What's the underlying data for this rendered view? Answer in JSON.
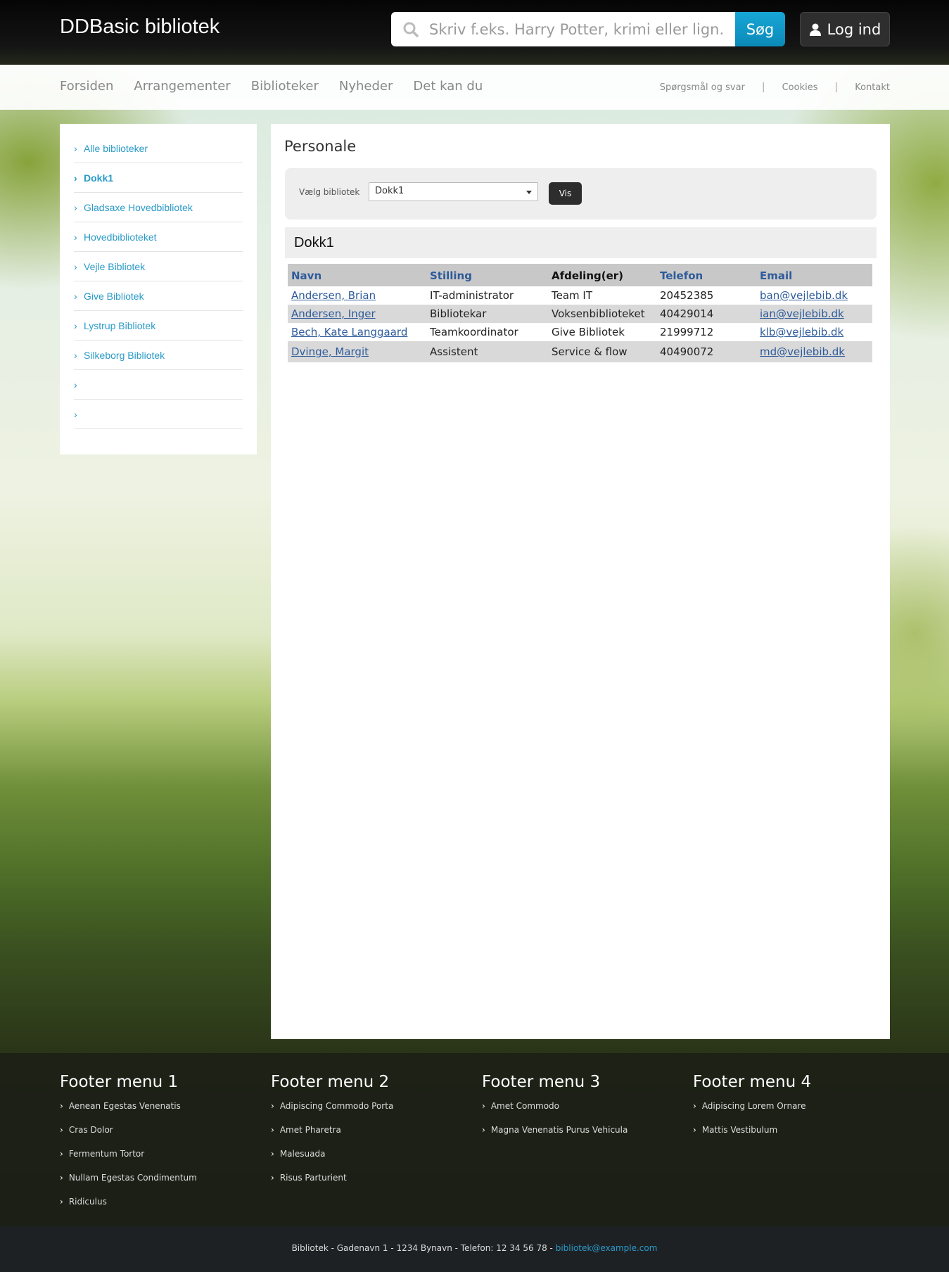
{
  "header": {
    "site_title": "DDBasic bibliotek",
    "search_placeholder": "Skriv f.eks. Harry Potter, krimi eller lign.",
    "search_button": "Søg",
    "login_button": "Log ind"
  },
  "nav": {
    "main": [
      "Forsiden",
      "Arrangementer",
      "Biblioteker",
      "Nyheder",
      "Det kan du"
    ],
    "secondary": [
      "Spørgsmål og svar",
      "Cookies",
      "Kontakt"
    ]
  },
  "sidebar": {
    "items": [
      {
        "label": "Alle biblioteker",
        "active": false
      },
      {
        "label": "Dokk1",
        "active": true
      },
      {
        "label": "Gladsaxe Hovedbibliotek",
        "active": false
      },
      {
        "label": "Hovedbiblioteket",
        "active": false
      },
      {
        "label": "Vejle Bibliotek",
        "active": false
      },
      {
        "label": "Give Bibliotek",
        "active": false
      },
      {
        "label": "Lystrup Bibliotek",
        "active": false
      },
      {
        "label": "Silkeborg Bibliotek",
        "active": false
      },
      {
        "label": "",
        "active": false
      },
      {
        "label": "",
        "active": false
      }
    ]
  },
  "main": {
    "title": "Personale",
    "filter": {
      "label": "Vælg bibliotek",
      "selected": "Dokk1",
      "button": "Vis"
    },
    "result_heading": "Dokk1",
    "table": {
      "headers": [
        "Navn",
        "Stilling",
        "Afdeling(er)",
        "Telefon",
        "Email"
      ],
      "rows": [
        [
          "Andersen, Brian",
          "IT-administrator",
          "Team IT",
          "20452385",
          "ban@vejlebib.dk"
        ],
        [
          "Andersen, Inger",
          "Bibliotekar",
          "Voksenbiblioteket",
          "40429014",
          "ian@vejlebib.dk"
        ],
        [
          "Bech, Kate Langgaard",
          "Teamkoordinator",
          "Give Bibliotek",
          "21999712",
          "klb@vejlebib.dk"
        ],
        [
          "Dvinge, Margit",
          "Assistent",
          "Service & flow",
          "40490072",
          "md@vejlebib.dk"
        ]
      ]
    }
  },
  "footer": {
    "columns": [
      {
        "title": "Footer menu 1",
        "items": [
          "Aenean Egestas Venenatis",
          "Cras Dolor",
          "Fermentum Tortor",
          "Nullam Egestas Condimentum",
          "Ridiculus"
        ]
      },
      {
        "title": "Footer menu 2",
        "items": [
          "Adipiscing Commodo Porta",
          "Amet Pharetra",
          "Malesuada",
          "Risus Parturient"
        ]
      },
      {
        "title": "Footer menu 3",
        "items": [
          "Amet Commodo",
          "Magna Venenatis Purus Vehicula"
        ]
      },
      {
        "title": "Footer menu 4",
        "items": [
          "Adipiscing Lorem Ornare",
          "Mattis Vestibulum"
        ]
      }
    ],
    "address_text": "Bibliotek - Gadenavn 1 - 1234 Bynavn - Telefon: 12 34 56 78 - ",
    "email": "bibliotek@example.com"
  },
  "colors": {
    "accent": "#2a9ac8",
    "search_button": "#0b8ab8",
    "link": "#2e5b9a"
  }
}
